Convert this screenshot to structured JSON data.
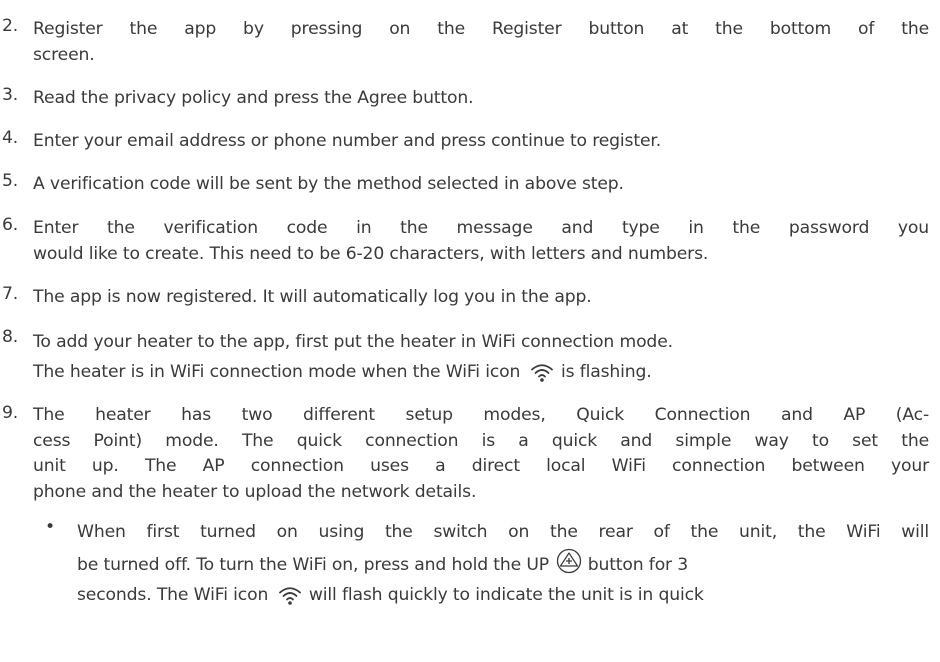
{
  "steps": [
    {
      "num": "2.",
      "lines": [
        "Register the app by pressing on the Register button at the bottom of the",
        "screen."
      ]
    },
    {
      "num": "3.",
      "lines": [
        "Read the privacy policy and press the Agree button."
      ]
    },
    {
      "num": "4.",
      "lines": [
        "Enter your email address or phone number and press continue to register."
      ]
    },
    {
      "num": "5.",
      "lines": [
        "A verification code will be sent by the method selected in above step."
      ]
    },
    {
      "num": "6.",
      "lines": [
        "Enter the verification code in the message and type in the password you",
        "would like to create. This need to be 6-20 characters, with letters and numbers."
      ]
    },
    {
      "num": "7.",
      "lines": [
        "The app is now registered. It will automatically log you in the app."
      ]
    },
    {
      "num": "8.",
      "line1": "To add your heater to the app, first put the heater in WiFi connection mode.",
      "line2_pre": "The heater is in WiFi connection mode when the WiFi icon",
      "line2_post": "is flashing."
    },
    {
      "num": "9.",
      "lines": [
        "The heater has two different setup modes, Quick Connection and AP (Ac-",
        "cess Point) mode. The quick connection is a quick and simple way to set the",
        "unit up. The AP connection uses a direct local WiFi connection between your",
        "phone and the heater to upload the network details."
      ]
    }
  ],
  "bullet": {
    "symbol": "•",
    "line1": "When first turned on using the switch on the rear of the unit, the WiFi will",
    "line2_pre": "be turned off. To turn the WiFi on, press and hold the UP",
    "line2_post": "button for 3",
    "line3_pre": "seconds. The WiFi icon",
    "line3_post": "will flash quickly to indicate the unit is in quick"
  },
  "icons": {
    "wifi": "wifi-icon",
    "up": "up-button-icon"
  }
}
